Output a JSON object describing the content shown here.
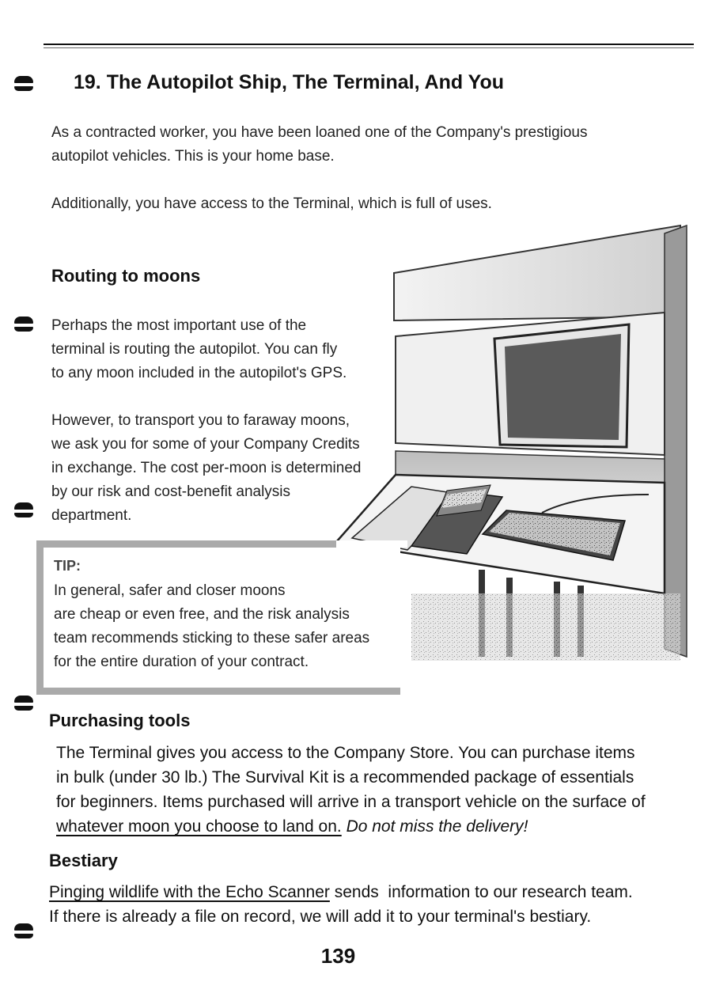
{
  "title": "19.  The Autopilot Ship, The Terminal, And You",
  "intro": {
    "line1": "As a contracted worker, you have been loaned one of the Company's prestigious",
    "line2": "autopilot vehicles. This is your home base.",
    "line3": "Additionally, you have access to the Terminal, which is full of uses."
  },
  "routing": {
    "heading": "Routing to moons",
    "p1": [
      "Perhaps the most important use of the",
      "terminal is routing the autopilot. You can fly",
      "to any moon included in the autopilot's GPS."
    ],
    "p2": [
      "However, to transport you to faraway moons,",
      "we ask you for some of your Company Credits",
      "in exchange. The cost per-moon is determined",
      "by our risk and cost-benefit analysis",
      "department."
    ]
  },
  "tip": {
    "label": "TIP:",
    "lines": [
      "In general, safer and closer moons",
      "are cheap or even free, and the risk analysis",
      "team recommends sticking to these safer areas",
      "for the entire duration of your contract."
    ]
  },
  "purchasing": {
    "heading": "Purchasing tools",
    "lines": [
      "The Terminal gives you access to the Company Store. You can purchase items",
      "in bulk (under 30 lb.) The Survival Kit is a recommended package of essentials",
      "for beginners. Items purchased will arrive in a transport vehicle on the surface of"
    ],
    "last_underlined": "whatever moon you choose to land on.",
    "last_italic": "Do not miss the delivery!"
  },
  "bestiary": {
    "heading": "Bestiary",
    "underlined": "Pinging wildlife with the Echo Scanner",
    "rest": " sends  information to our research team.",
    "line2": "If there is already a file on record, we will add it to your terminal's bestiary."
  },
  "page_number": "139",
  "illustration": "terminal-console-illustration"
}
